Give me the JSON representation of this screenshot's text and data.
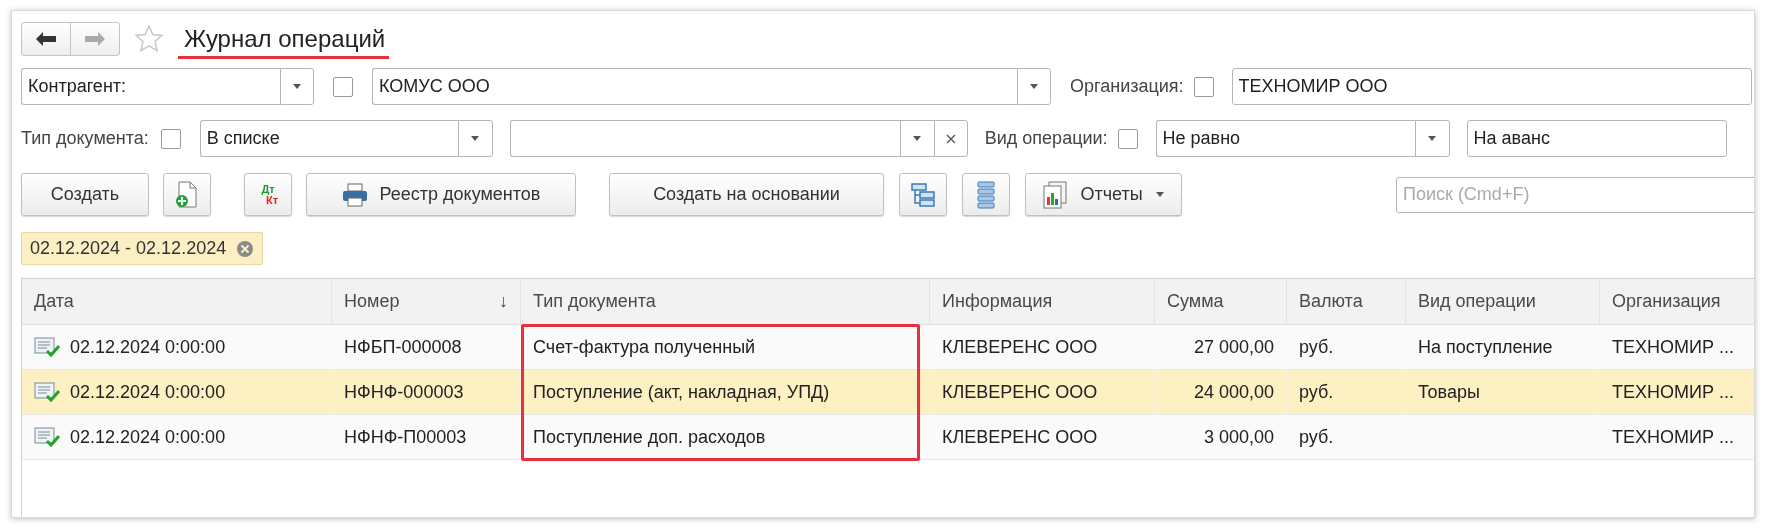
{
  "window": {
    "title": "Журнал операций",
    "title_underlined": true,
    "favorite": false
  },
  "nav": [
    {
      "kind": "back",
      "disabled": false
    },
    {
      "kind": "forward",
      "disabled": true
    }
  ],
  "filters": {
    "contractor": {
      "field": "Контрагент:",
      "checked": false,
      "value": "КОМУС ООО"
    },
    "organization": {
      "label": "Организация:",
      "checked": false,
      "value": "ТЕХНОМИР ООО"
    },
    "document_type": {
      "label": "Тип документа:",
      "checked": false,
      "condition": "В списке"
    },
    "operation_type": {
      "label": "Вид операции:",
      "checked": false,
      "condition": "Не равно",
      "value": "На аванс"
    }
  },
  "toolbar": [
    {
      "kind": "text",
      "label": "Создать"
    },
    {
      "kind": "new-doc"
    },
    {
      "kind": "dtkt",
      "top": "Дт",
      "bottom": "Кт"
    },
    {
      "kind": "print",
      "label": "Реестр документов"
    },
    {
      "kind": "text",
      "label": "Создать на основании"
    },
    {
      "kind": "hierarchy"
    },
    {
      "kind": "list"
    },
    {
      "kind": "reports",
      "label": "Отчеты"
    }
  ],
  "search": {
    "placeholder": "Поиск (Cmd+F)"
  },
  "period_chip": {
    "label": "02.12.2024 - 02.12.2024"
  },
  "table": {
    "columns": [
      {
        "label": "Дата",
        "kind": "text"
      },
      {
        "label": "Номер",
        "kind": "text",
        "sort": "↓"
      },
      {
        "label": "Тип документа",
        "kind": "text",
        "highlighted": true
      },
      {
        "label": "Информация",
        "kind": "text"
      },
      {
        "label": "Сумма",
        "kind": "amount"
      },
      {
        "label": "Валюта",
        "kind": "text"
      },
      {
        "label": "Вид операции",
        "kind": "text"
      },
      {
        "label": "Организация",
        "kind": "text"
      }
    ],
    "rows": [
      {
        "selected": false,
        "posted": true,
        "cells": [
          "02.12.2024 0:00:00",
          "НФБП-000008",
          "Счет-фактура полученный",
          "КЛЕВЕРЕНС ООО",
          "27 000,00",
          "руб.",
          "На поступление",
          "ТЕХНОМИР ..."
        ]
      },
      {
        "selected": true,
        "posted": true,
        "cells": [
          "02.12.2024 0:00:00",
          "НФНФ-000003",
          "Поступление (акт, накладная, УПД)",
          "КЛЕВЕРЕНС ООО",
          "24 000,00",
          "руб.",
          "Товары",
          "ТЕХНОМИР ..."
        ]
      },
      {
        "selected": false,
        "posted": true,
        "cells": [
          "02.12.2024 0:00:00",
          "НФНФ-П00003",
          "Поступление доп. расходов",
          "КЛЕВЕРЕНС ООО",
          "3 000,00",
          "руб.",
          null,
          "ТЕХНОМИР ..."
        ]
      }
    ]
  }
}
